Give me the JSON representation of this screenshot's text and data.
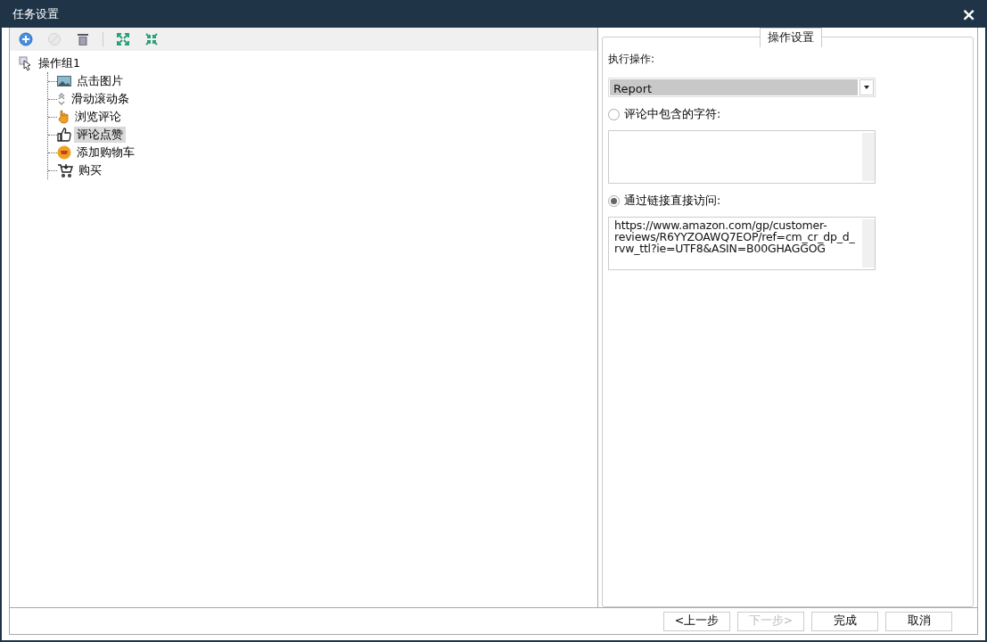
{
  "window": {
    "title": "任务设置",
    "close": "×"
  },
  "toolbar": [
    {
      "kind": "add",
      "disabled": false
    },
    {
      "kind": "block",
      "disabled": true
    },
    {
      "kind": "delete",
      "disabled": false
    },
    {
      "kind": "expand",
      "disabled": false
    },
    {
      "kind": "collapse",
      "disabled": false
    }
  ],
  "tree": [
    {
      "label": "操作组1",
      "kind": "group",
      "selected": false,
      "children": [
        {
          "label": "点击图片",
          "kind": "image",
          "selected": false
        },
        {
          "label": "滑动滚动条",
          "kind": "scroll",
          "selected": false
        },
        {
          "label": "浏览评论",
          "kind": "hand",
          "selected": false
        },
        {
          "label": "评论点赞",
          "kind": "thumb",
          "selected": true
        },
        {
          "label": "添加购物车",
          "kind": "cart-add",
          "selected": false
        },
        {
          "label": "购买",
          "kind": "cart",
          "selected": false
        }
      ]
    }
  ],
  "settings": {
    "legend": "操作设置",
    "action_label": "执行操作:",
    "action_value": "Report",
    "options": [
      {
        "label": "评论中包含的字符:",
        "selected": false
      },
      {
        "label": "通过链接直接访问:",
        "selected": true,
        "value": "https://www.amazon.com/gp/customer-reviews/R6YYZOAWQ7EOP/ref=cm_cr_dp_d_rvw_ttl?ie=UTF8&ASIN=B00GHAGGOG"
      }
    ]
  },
  "buttons": [
    {
      "label": "<上一步",
      "disabled": false
    },
    {
      "label": "下一步>",
      "disabled": true
    },
    {
      "label": "完成",
      "disabled": false
    },
    {
      "label": "取消",
      "disabled": false
    }
  ]
}
